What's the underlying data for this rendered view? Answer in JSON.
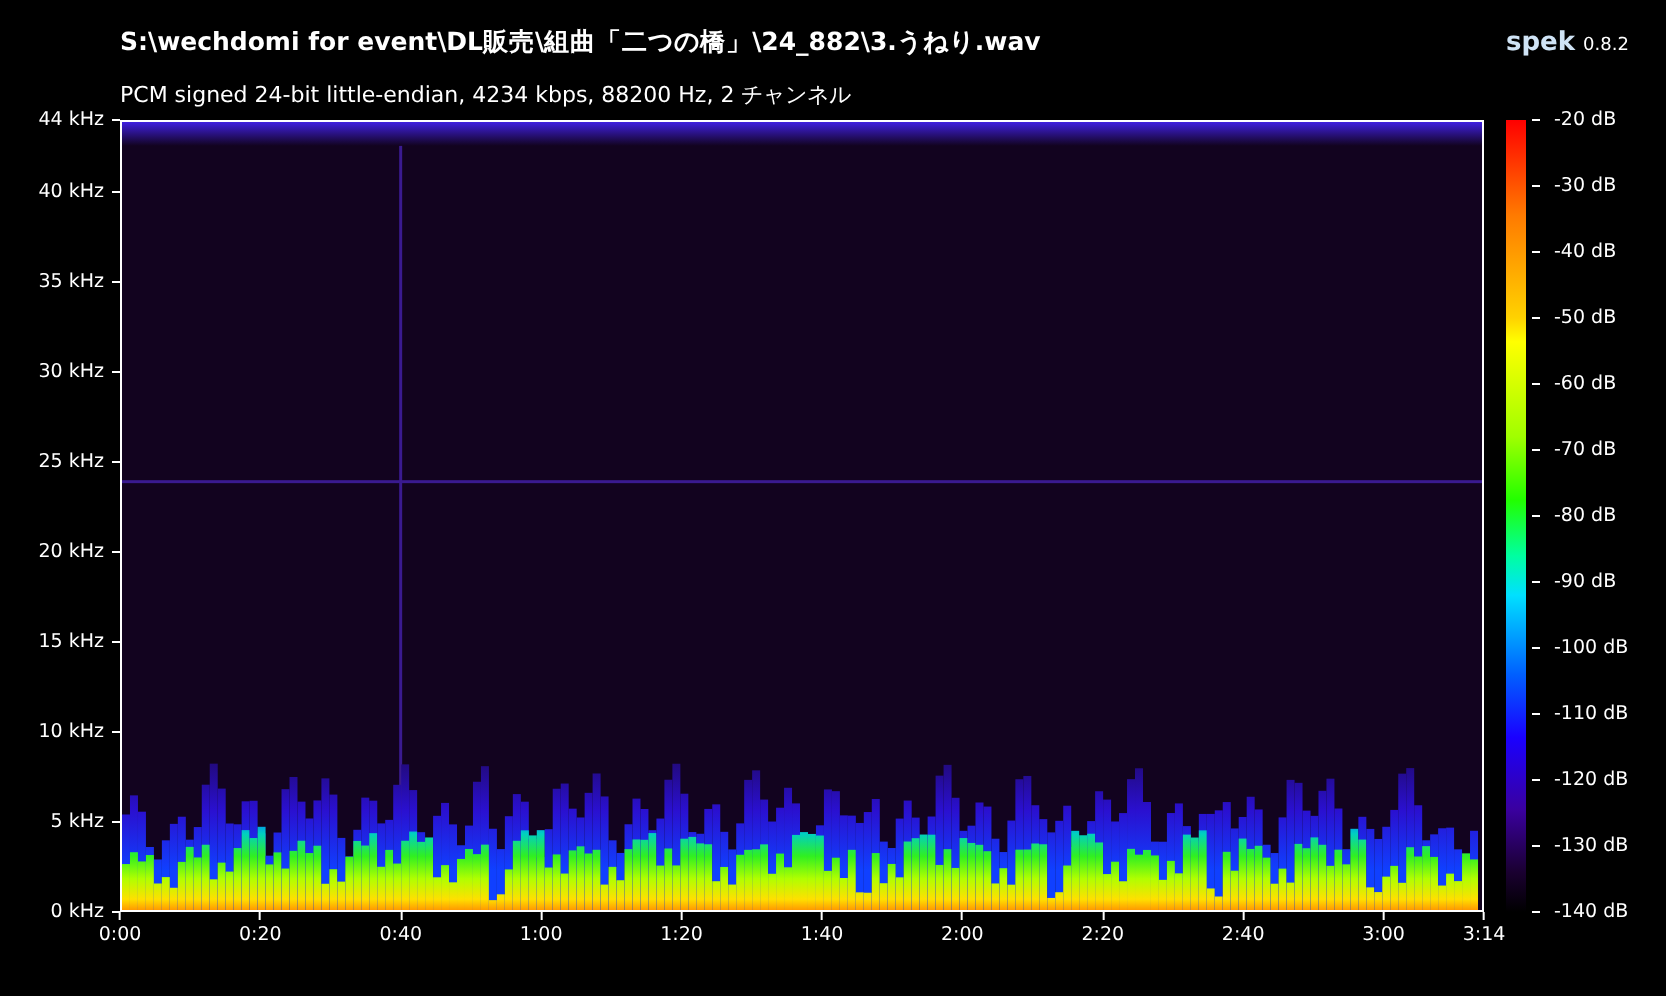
{
  "window": {
    "title": "S:\\wechdomi for event\\DL販売\\組曲「二つの橋」\\24_882\\3.うねり.wav",
    "app_name": "spek",
    "app_version": "0.8.2"
  },
  "stream_info": "PCM signed 24-bit little-endian, 4234 kbps, 88200 Hz, 2 チャンネル",
  "frequency_axis": {
    "labels": [
      "44 kHz",
      "40 kHz",
      "35 kHz",
      "30 kHz",
      "25 kHz",
      "20 kHz",
      "15 kHz",
      "10 kHz",
      "5 kHz",
      "0 kHz"
    ]
  },
  "time_axis": {
    "labels": [
      "0:00",
      "0:20",
      "0:40",
      "1:00",
      "1:20",
      "1:40",
      "2:00",
      "2:20",
      "2:40",
      "3:00",
      "3:14"
    ]
  },
  "color_scale": {
    "labels": [
      "-20 dB",
      "-30 dB",
      "-40 dB",
      "-50 dB",
      "-60 dB",
      "-70 dB",
      "-80 dB",
      "-90 dB",
      "-100 dB",
      "-110 dB",
      "-120 dB",
      "-130 dB",
      "-140 dB"
    ]
  }
}
